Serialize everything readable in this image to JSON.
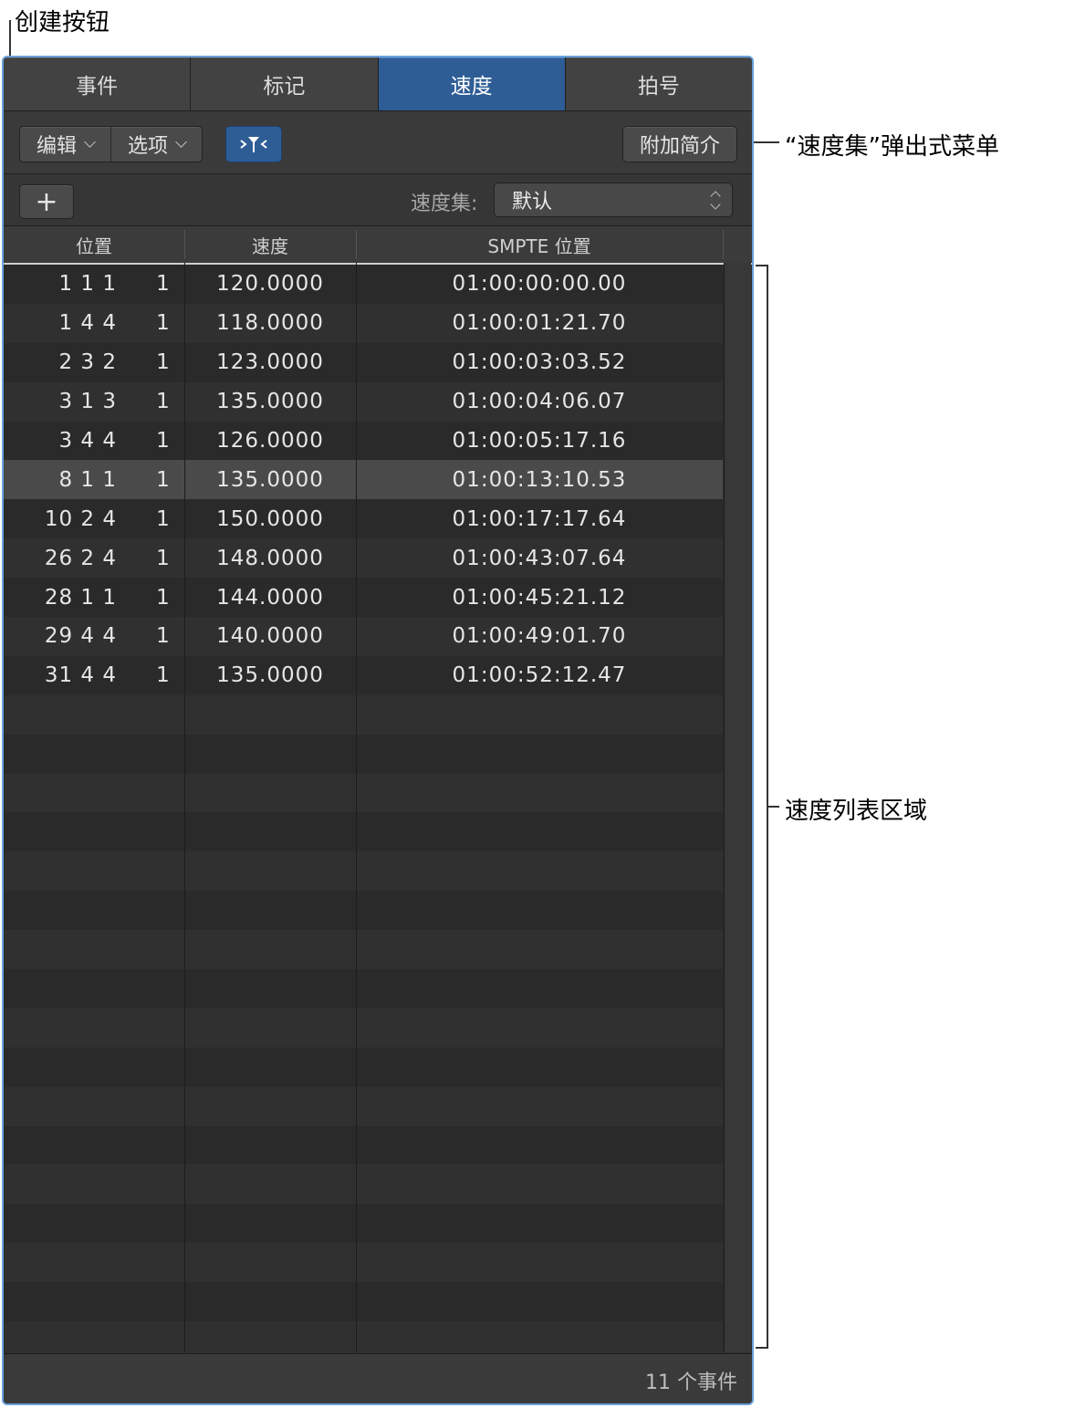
{
  "callouts": {
    "create_button": "创建按钮",
    "tempo_set_menu": "“速度集”弹出式菜单",
    "tempo_list_area": "速度列表区域"
  },
  "tabs": [
    {
      "label": "事件",
      "active": false
    },
    {
      "label": "标记",
      "active": false
    },
    {
      "label": "速度",
      "active": true
    },
    {
      "label": "拍号",
      "active": false
    }
  ],
  "toolbar": {
    "edit_label": "编辑",
    "options_label": "选项",
    "catch_icon": "catch-playhead-icon",
    "add_info_label": "附加简介"
  },
  "setbar": {
    "create_glyph": "+",
    "tempo_set_label": "速度集:",
    "tempo_set_value": "默认"
  },
  "columns": {
    "position": "位置",
    "tempo": "速度",
    "smpte": "SMPTE 位置"
  },
  "rows": [
    {
      "pos": "1 1 1",
      "tick": "1",
      "tempo": "120.0000",
      "smpte": "01:00:00:00.00",
      "selected": false
    },
    {
      "pos": "1 4 4",
      "tick": "1",
      "tempo": "118.0000",
      "smpte": "01:00:01:21.70",
      "selected": false
    },
    {
      "pos": "2 3 2",
      "tick": "1",
      "tempo": "123.0000",
      "smpte": "01:00:03:03.52",
      "selected": false
    },
    {
      "pos": "3 1 3",
      "tick": "1",
      "tempo": "135.0000",
      "smpte": "01:00:04:06.07",
      "selected": false
    },
    {
      "pos": "3 4 4",
      "tick": "1",
      "tempo": "126.0000",
      "smpte": "01:00:05:17.16",
      "selected": false
    },
    {
      "pos": "8 1 1",
      "tick": "1",
      "tempo": "135.0000",
      "smpte": "01:00:13:10.53",
      "selected": true
    },
    {
      "pos": "10 2 4",
      "tick": "1",
      "tempo": "150.0000",
      "smpte": "01:00:17:17.64",
      "selected": false
    },
    {
      "pos": "26 2 4",
      "tick": "1",
      "tempo": "148.0000",
      "smpte": "01:00:43:07.64",
      "selected": false
    },
    {
      "pos": "28 1 1",
      "tick": "1",
      "tempo": "144.0000",
      "smpte": "01:00:45:21.12",
      "selected": false
    },
    {
      "pos": "29 4 4",
      "tick": "1",
      "tempo": "140.0000",
      "smpte": "01:00:49:01.70",
      "selected": false
    },
    {
      "pos": "31 4 4",
      "tick": "1",
      "tempo": "135.0000",
      "smpte": "01:00:52:12.47",
      "selected": false
    }
  ],
  "footer": {
    "event_count": "11 个事件"
  },
  "colors": {
    "accent": "#2e5d96",
    "window_border": "#6aa2dc"
  }
}
